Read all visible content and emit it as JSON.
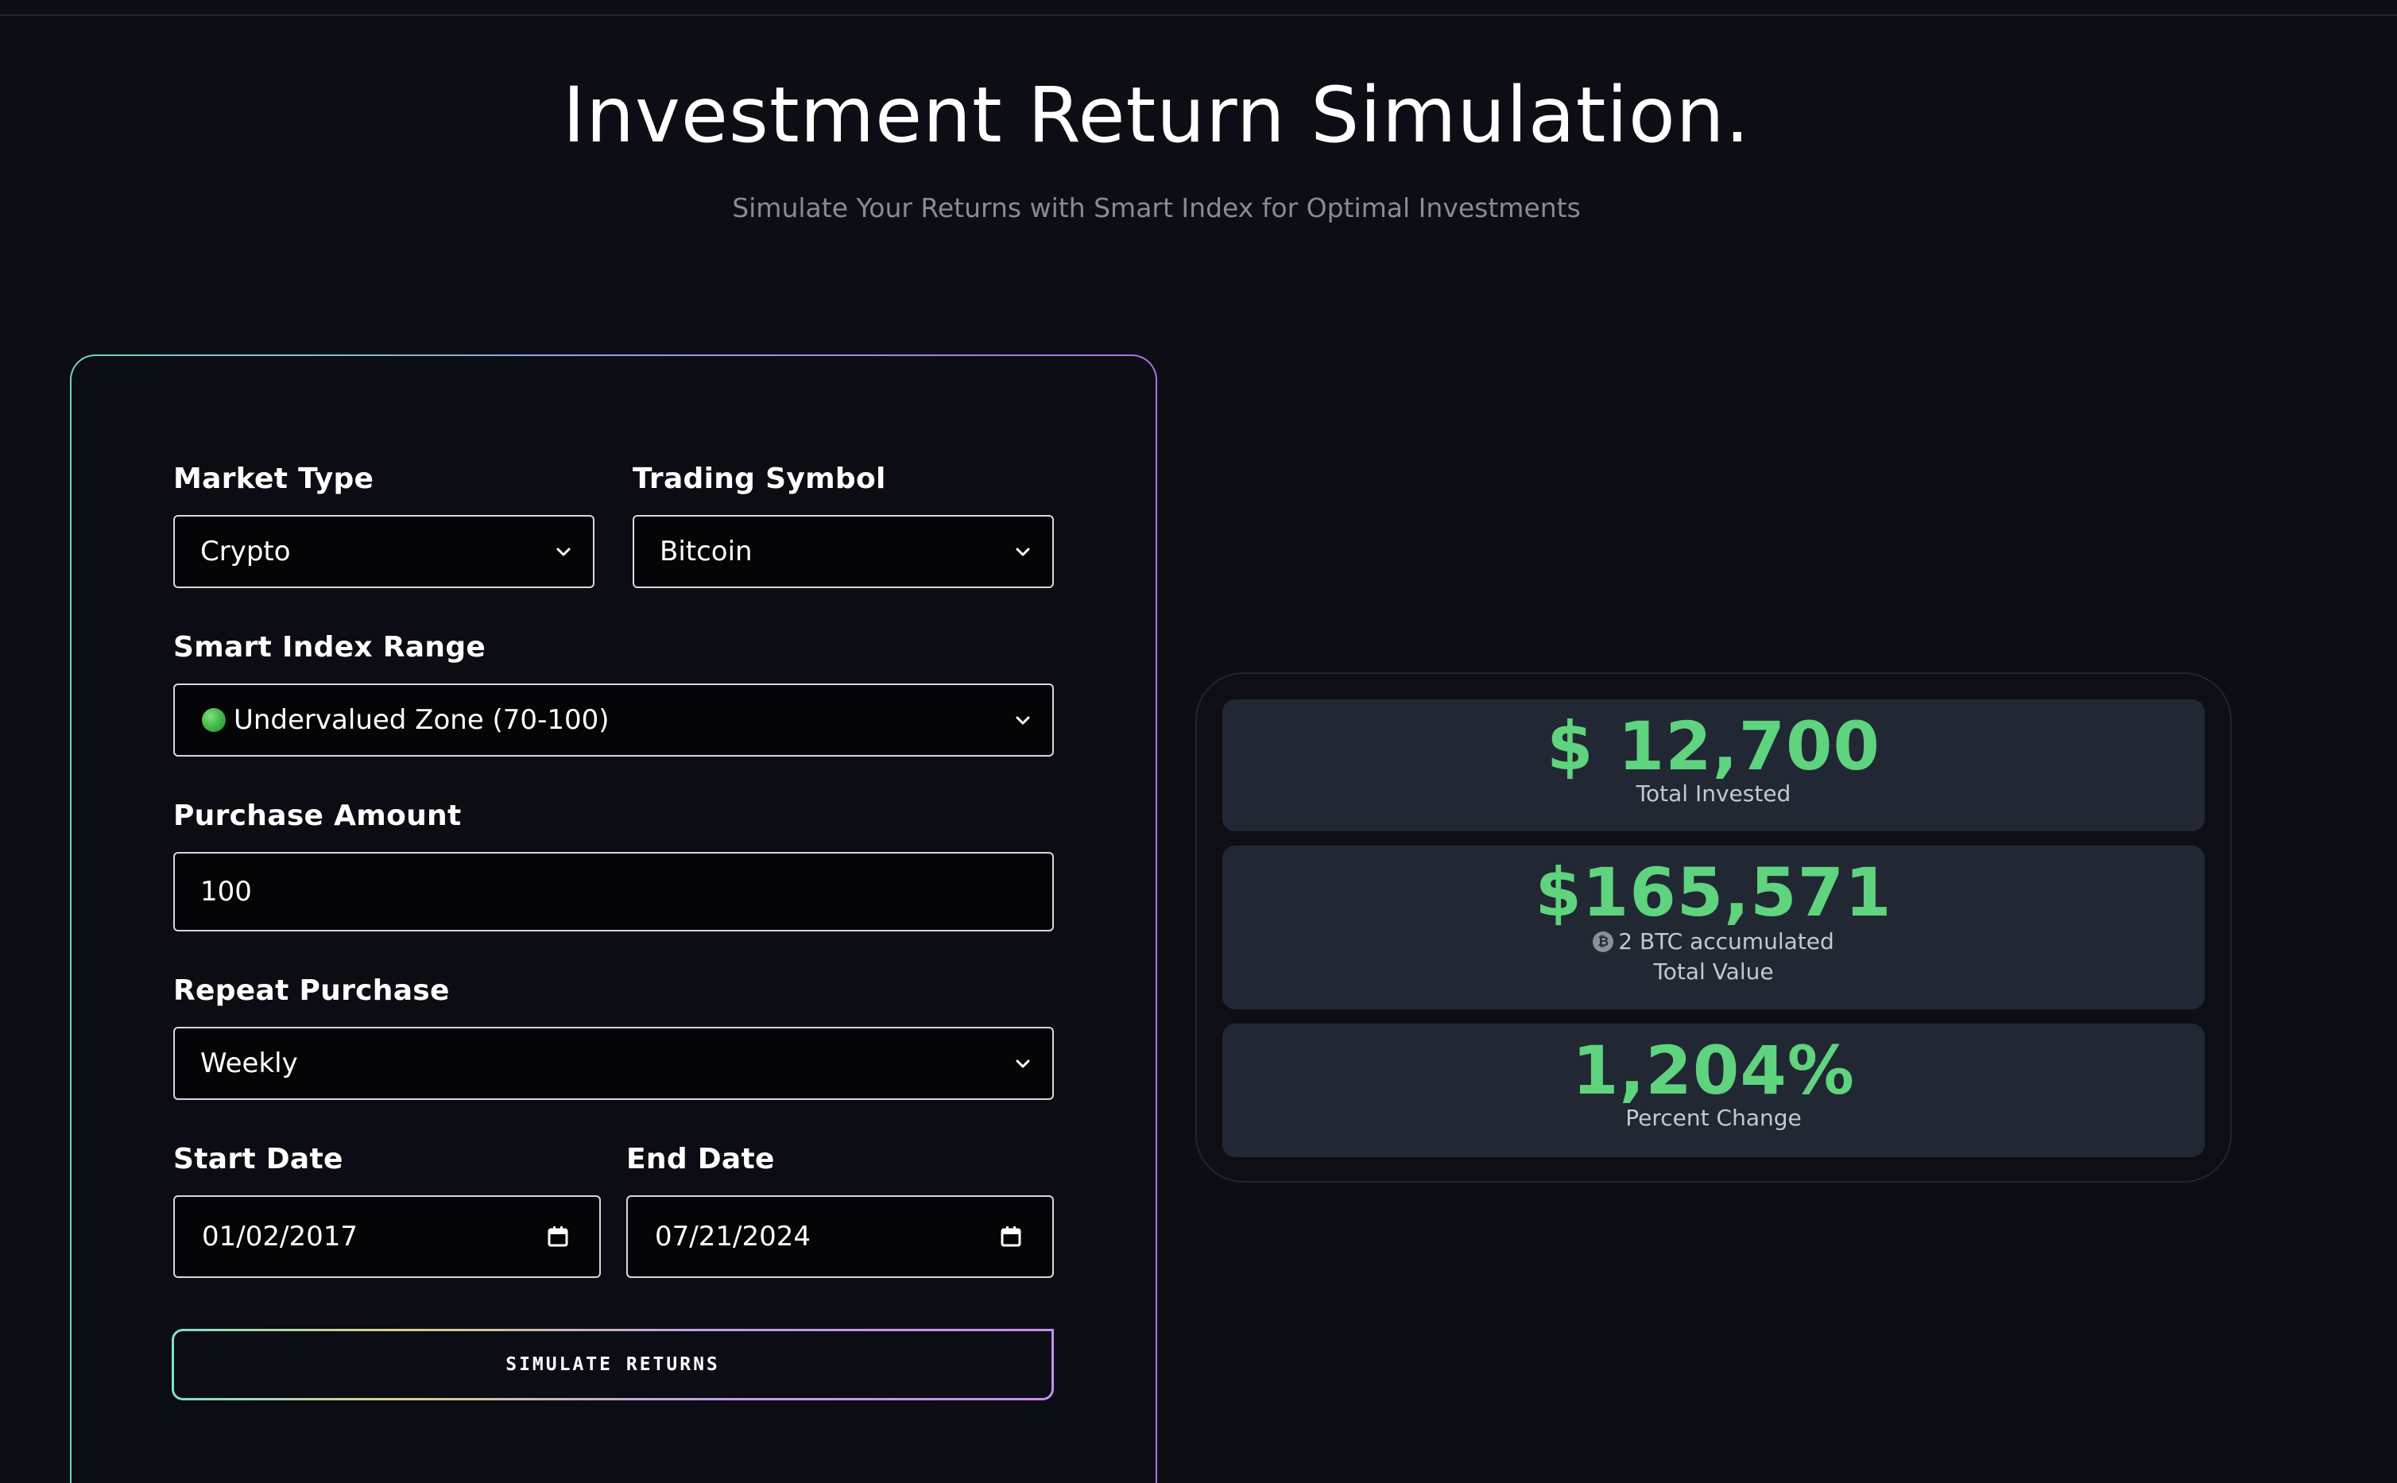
{
  "header": {
    "title": "Investment Return Simulation.",
    "subtitle": "Simulate Your Returns with Smart Index for Optimal Investments"
  },
  "form": {
    "market_type": {
      "label": "Market Type",
      "value": "Crypto"
    },
    "trading_symbol": {
      "label": "Trading Symbol",
      "value": "Bitcoin"
    },
    "smart_index_range": {
      "label": "Smart Index Range",
      "value": "Undervalued Zone (70-100)",
      "indicator_color": "#3fb244"
    },
    "purchase_amount": {
      "label": "Purchase Amount",
      "value": "100"
    },
    "repeat_purchase": {
      "label": "Repeat Purchase",
      "value": "Weekly"
    },
    "start_date": {
      "label": "Start Date",
      "value": "01/02/2017"
    },
    "end_date": {
      "label": "End Date",
      "value": "07/21/2024"
    },
    "submit_label": "SIMULATE RETURNS"
  },
  "results": {
    "total_invested": {
      "value": "$ 12,700",
      "label": "Total Invested"
    },
    "total_value": {
      "value": "$165,571",
      "accumulated": "2 BTC accumulated",
      "coin_icon": "bitcoin-icon",
      "label": "Total Value"
    },
    "percent_change": {
      "value": "1,204%",
      "label": "Percent Change"
    }
  },
  "colors": {
    "background": "#0d0d15",
    "accent_green": "#5fd37e",
    "tile_background": "#212834",
    "card_gradient": [
      "#6fd3c1",
      "#8aa6e8",
      "#b06ee6"
    ]
  }
}
